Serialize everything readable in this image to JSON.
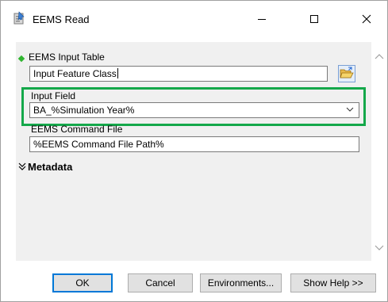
{
  "window": {
    "title": "EEMS Read",
    "icon": "eems-tool-icon"
  },
  "titlebar_buttons": {
    "minimize_icon": "minimize-icon",
    "maximize_icon": "maximize-icon",
    "close_icon": "close-icon"
  },
  "form": {
    "input_table": {
      "label": "EEMS Input Table",
      "value": "Input Feature Class",
      "required_marker_color": "#2fb52f",
      "browse_icon": "open-folder-icon"
    },
    "input_field": {
      "label": "Input Field",
      "value": "BA_%Simulation Year%",
      "highlight_color": "#14a84a"
    },
    "command_file": {
      "label": "EEMS Command File",
      "value": "%EEMS Command File Path%"
    },
    "metadata": {
      "label": "Metadata",
      "icon": "double-chevron-down-icon"
    }
  },
  "buttons": {
    "ok": "OK",
    "cancel": "Cancel",
    "environments": "Environments...",
    "show_help": "Show Help >>"
  }
}
